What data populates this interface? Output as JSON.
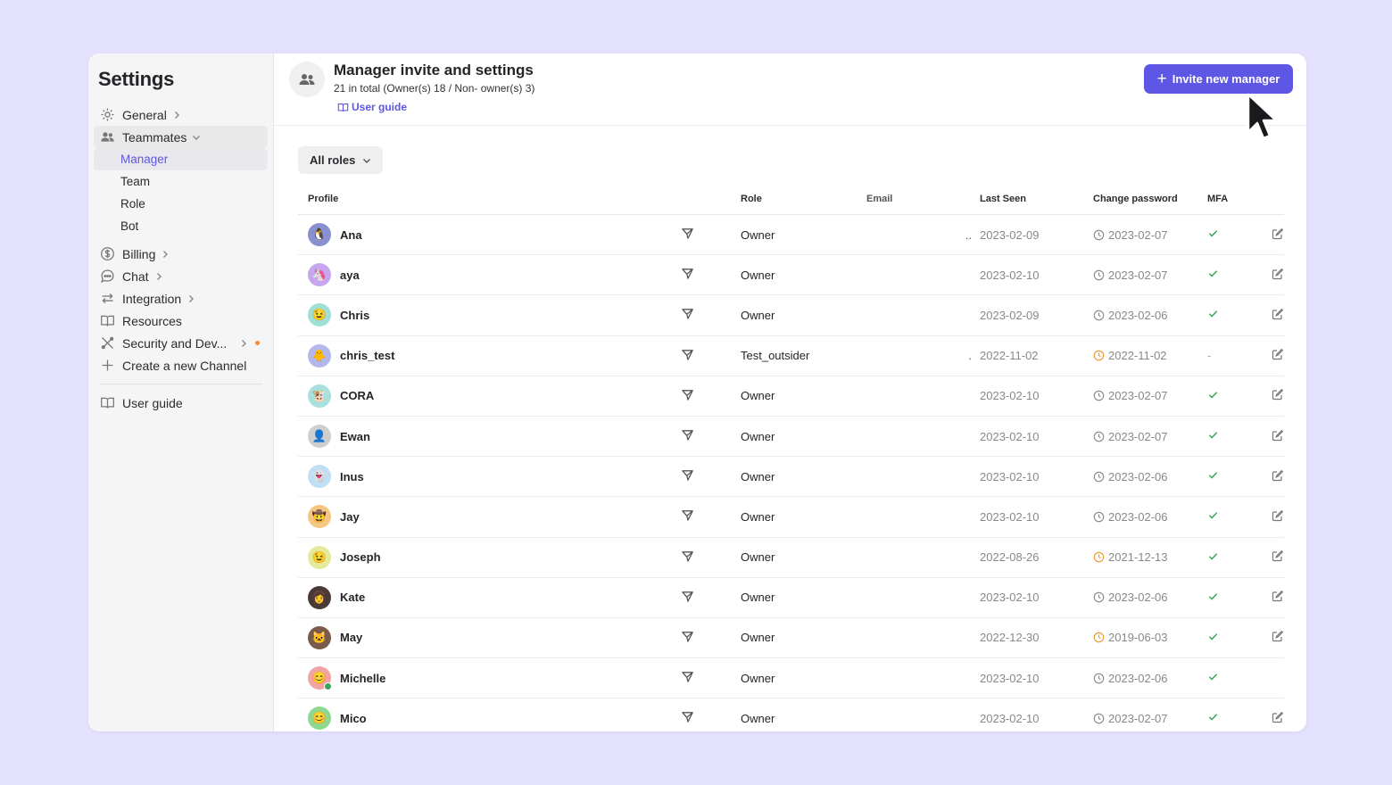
{
  "sidebar": {
    "title": "Settings",
    "items": [
      {
        "label": "General",
        "icon": "gear-icon"
      },
      {
        "label": "Teammates",
        "icon": "people-icon"
      },
      {
        "label": "Billing",
        "icon": "dollar-icon"
      },
      {
        "label": "Chat",
        "icon": "chat-icon"
      },
      {
        "label": "Integration",
        "icon": "arrows-icon"
      },
      {
        "label": "Resources",
        "icon": "book-icon"
      },
      {
        "label": "Security and Dev...",
        "icon": "tools-icon"
      },
      {
        "label": "Create a new Channel",
        "icon": "plus-icon"
      },
      {
        "label": "User guide",
        "icon": "book-icon"
      }
    ],
    "sub_items": [
      "Manager",
      "Team",
      "Role",
      "Bot"
    ]
  },
  "header": {
    "title": "Manager invite and settings",
    "subtitle": "21 in total (Owner(s) 18 / Non- owner(s) 3)",
    "guide_label": "User guide",
    "invite_label": "Invite new manager"
  },
  "filter": {
    "label": "All roles"
  },
  "table": {
    "columns": [
      "Profile",
      "Role",
      "Email",
      "Last Seen",
      "Change password",
      "MFA"
    ],
    "rows": [
      {
        "name": "Ana",
        "role": "Owner",
        "email": "..",
        "last_seen": "2023-02-09",
        "pw": "2023-02-07",
        "pw_warn": false,
        "mfa": "check",
        "edit": true,
        "emoji": "🐧",
        "bg": "#8a8fcf"
      },
      {
        "name": "aya",
        "role": "Owner",
        "email": "",
        "last_seen": "2023-02-10",
        "pw": "2023-02-07",
        "pw_warn": false,
        "mfa": "check",
        "edit": true,
        "emoji": "🦄",
        "bg": "#c8a6ef"
      },
      {
        "name": "Chris",
        "role": "Owner",
        "email": "",
        "last_seen": "2023-02-09",
        "pw": "2023-02-06",
        "pw_warn": false,
        "mfa": "check",
        "edit": true,
        "emoji": "😉",
        "bg": "#9edfd8"
      },
      {
        "name": "chris_test",
        "role": "Test_outsider",
        "email": ".",
        "last_seen": "2022-11-02",
        "pw": "2022-11-02",
        "pw_warn": true,
        "mfa": "-",
        "edit": true,
        "emoji": "🐥",
        "bg": "#b3b8ec"
      },
      {
        "name": "CORA",
        "role": "Owner",
        "email": "",
        "last_seen": "2023-02-10",
        "pw": "2023-02-07",
        "pw_warn": false,
        "mfa": "check",
        "edit": true,
        "emoji": "🐮",
        "bg": "#a7e0dc"
      },
      {
        "name": "Ewan",
        "role": "Owner",
        "email": "",
        "last_seen": "2023-02-10",
        "pw": "2023-02-07",
        "pw_warn": false,
        "mfa": "check",
        "edit": true,
        "emoji": "👤",
        "bg": "#cfcfcf"
      },
      {
        "name": "Inus",
        "role": "Owner",
        "email": "",
        "last_seen": "2023-02-10",
        "pw": "2023-02-06",
        "pw_warn": false,
        "mfa": "check",
        "edit": true,
        "emoji": "👻",
        "bg": "#bfe0f4"
      },
      {
        "name": "Jay",
        "role": "Owner",
        "email": "",
        "last_seen": "2023-02-10",
        "pw": "2023-02-06",
        "pw_warn": false,
        "mfa": "check",
        "edit": true,
        "emoji": "🤠",
        "bg": "#f3c682"
      },
      {
        "name": "Joseph",
        "role": "Owner",
        "email": "",
        "last_seen": "2022-08-26",
        "pw": "2021-12-13",
        "pw_warn": true,
        "mfa": "check",
        "edit": true,
        "emoji": "😉",
        "bg": "#e5ea9a"
      },
      {
        "name": "Kate",
        "role": "Owner",
        "email": "",
        "last_seen": "2023-02-10",
        "pw": "2023-02-06",
        "pw_warn": false,
        "mfa": "check",
        "edit": true,
        "emoji": "👩",
        "bg": "#4a3a36"
      },
      {
        "name": "May",
        "role": "Owner",
        "email": "",
        "last_seen": "2022-12-30",
        "pw": "2019-06-03",
        "pw_warn": true,
        "mfa": "check",
        "edit": true,
        "emoji": "🐱",
        "bg": "#7a5a4a"
      },
      {
        "name": "Michelle",
        "role": "Owner",
        "email": "",
        "last_seen": "2023-02-10",
        "pw": "2023-02-06",
        "pw_warn": false,
        "mfa": "check",
        "edit": false,
        "emoji": "😊",
        "bg": "#f2a3a3",
        "online": true
      },
      {
        "name": "Mico",
        "role": "Owner",
        "email": "",
        "last_seen": "2023-02-10",
        "pw": "2023-02-07",
        "pw_warn": false,
        "mfa": "check",
        "edit": true,
        "emoji": "😊",
        "bg": "#8ed890"
      }
    ]
  },
  "colors": {
    "accent": "#5e56e5",
    "background": "#e3e1fd",
    "check": "#3aa55d",
    "warn": "#f0962b"
  }
}
